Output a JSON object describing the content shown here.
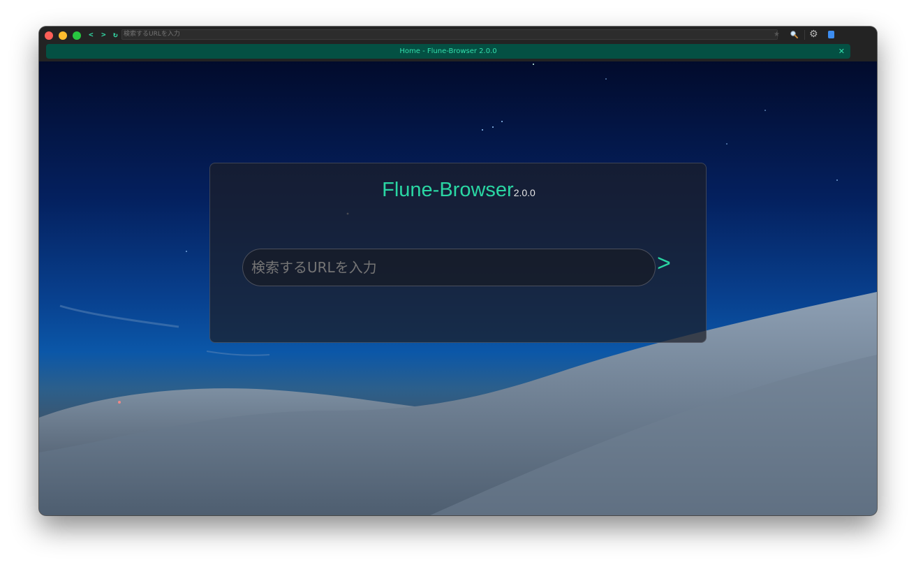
{
  "toolbar": {
    "back_label": "<",
    "forward_label": ">",
    "reload_label": "↻",
    "address_placeholder": "検索するURLを入力",
    "bookmark_icon": "star-icon",
    "search_icon": "magnifier-icon",
    "settings_icon": "gear-icon",
    "reader_icon": "book-icon"
  },
  "tabs": [
    {
      "title": "Home - Flune-Browser 2.0.0",
      "active": true,
      "close_label": "✕"
    }
  ],
  "new_tab_label": "+",
  "home": {
    "brand": "Flune-Browser",
    "version": "2.0.0",
    "search_placeholder": "検索するURLを入力",
    "go_label": ">"
  },
  "colors": {
    "accent": "#2ad6a3",
    "tab_bg": "#045043",
    "chrome_bg": "#232323"
  }
}
